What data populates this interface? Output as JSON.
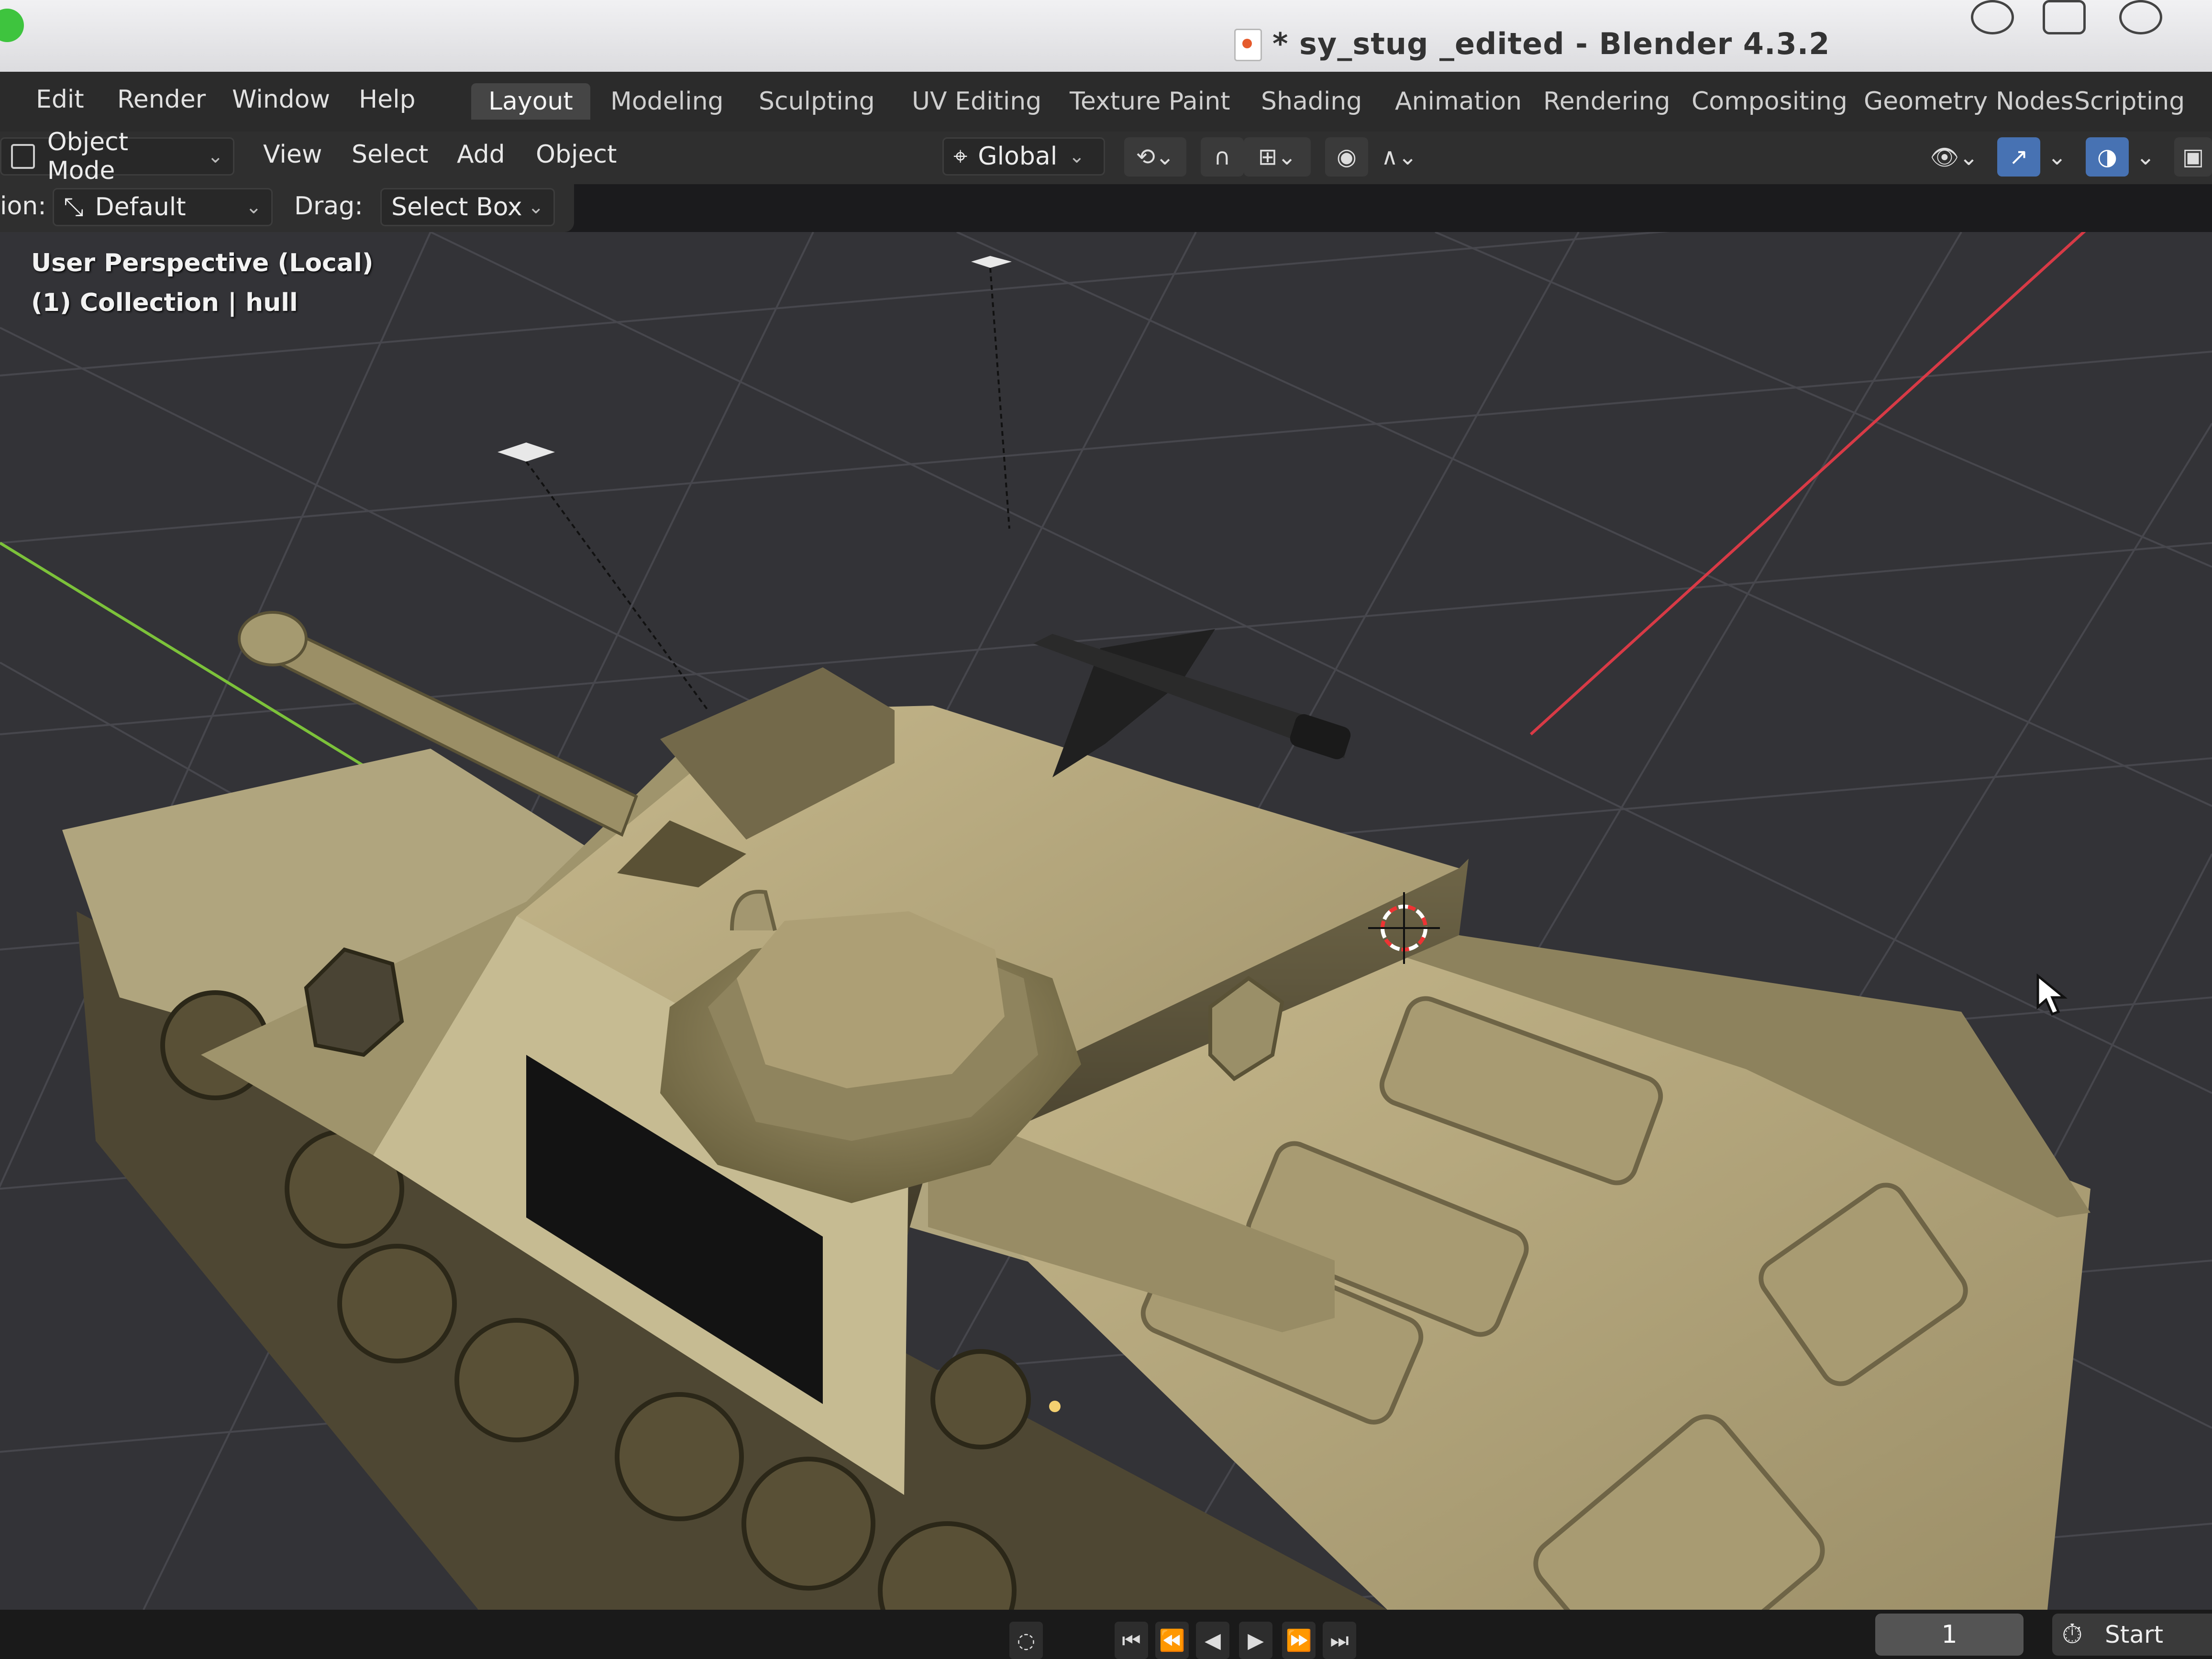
{
  "window": {
    "title": "* sy_stug _edited - Blender 4.3.2"
  },
  "menu": {
    "items": [
      "Edit",
      "Render",
      "Window",
      "Help"
    ]
  },
  "workspaces": {
    "active": "Layout",
    "tabs": [
      "Layout",
      "Modeling",
      "Sculpting",
      "UV Editing",
      "Texture Paint",
      "Shading",
      "Animation",
      "Rendering",
      "Compositing",
      "Geometry Nodes",
      "Scripting"
    ]
  },
  "header": {
    "mode": "Object Mode",
    "menus": [
      "View",
      "Select",
      "Add",
      "Object"
    ],
    "transform_orientation": "Global"
  },
  "tool_settings": {
    "orientation_label_partial": "ion:",
    "orientation_value": "Default",
    "drag_label": "Drag:",
    "drag_value": "Select Box"
  },
  "viewport": {
    "view_name": "User Perspective (Local)",
    "collection_info": "(1) Collection | hull",
    "object_color": "#b7aa80",
    "grid_color": "#4a4a50",
    "x_axis_color": "#d83a46",
    "y_axis_color": "#7cc23a"
  },
  "timeline": {
    "current_frame": "1",
    "start_label": "Start"
  },
  "icons": [
    "gear-icon",
    "file-icon",
    "clock-icon",
    "mouse-cursor-icon",
    "3d-cursor-icon",
    "snap-icon",
    "proportional-edit-icon",
    "visibility-icon",
    "gizmo-icon",
    "overlay-icon",
    "xray-icon",
    "play-icon"
  ]
}
